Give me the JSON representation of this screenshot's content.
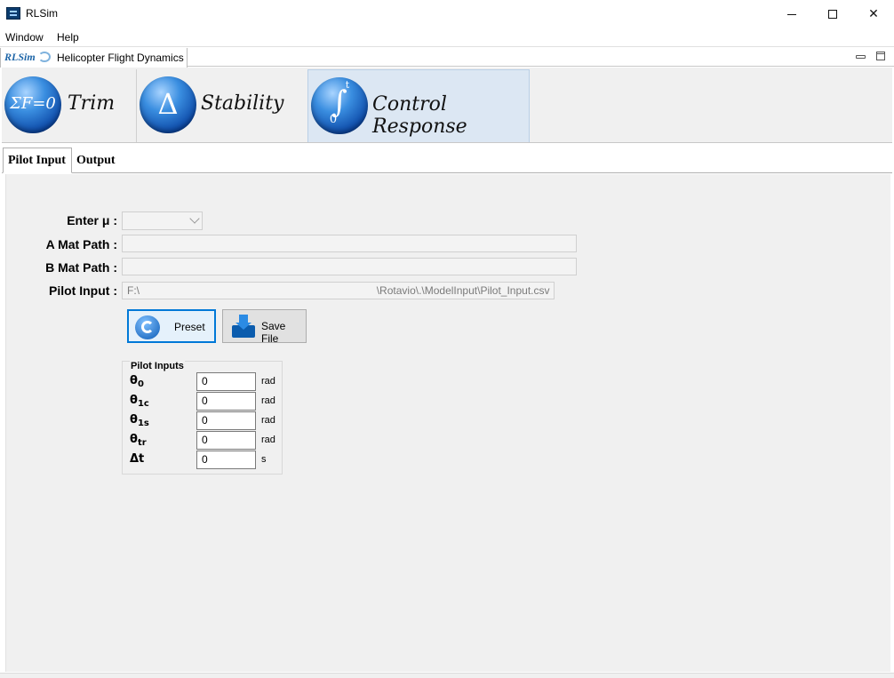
{
  "window": {
    "title": "RLSim",
    "min_label": "",
    "max_label": "",
    "close_label": "✕"
  },
  "menu": {
    "items": [
      "Window",
      "Help"
    ]
  },
  "view_tab": {
    "logo": "RLSim",
    "label": "Helicopter Flight Dynamics"
  },
  "modes": [
    {
      "label": "Trim",
      "icon_text": "ΣF=0",
      "icon": "sum-forces-icon"
    },
    {
      "label": "Stability",
      "icon_text": "Δ",
      "icon": "delta-icon"
    },
    {
      "label": "Control Response",
      "icon_text": "∫",
      "icon_sub": "0",
      "icon_sup": "t",
      "icon": "integral-icon",
      "selected": true
    }
  ],
  "subtabs": [
    {
      "label": "Pilot Input",
      "selected": true
    },
    {
      "label": "Output",
      "selected": false
    }
  ],
  "form": {
    "mu_label": "Enter μ :",
    "mu_value": "",
    "a_mat_label": "A Mat Path :",
    "a_mat_value": "",
    "b_mat_label": "B Mat Path :",
    "b_mat_value": "",
    "pilot_input_label": "Pilot Input :",
    "pilot_input_value": "F:\\                                                                                \\Rotavio\\.\\ModelInput\\Pilot_Input.csv"
  },
  "buttons": {
    "preset": "Preset",
    "save_file": "Save File"
  },
  "pilot_inputs": {
    "title": "Pilot Inputs",
    "rows": [
      {
        "symbol": "θ",
        "sub": "0",
        "value": "0",
        "unit": "rad"
      },
      {
        "symbol": "θ",
        "sub": "1c",
        "value": "0",
        "unit": "rad"
      },
      {
        "symbol": "θ",
        "sub": "1s",
        "value": "0",
        "unit": "rad"
      },
      {
        "symbol": "θ",
        "sub": "tr",
        "value": "0",
        "unit": "rad"
      },
      {
        "symbol": "Δt",
        "sub": "",
        "value": "0",
        "unit": "s"
      }
    ]
  },
  "colors": {
    "accent": "#0078d7",
    "orb": "#0d4aa8",
    "selected_tab": "#dce7f3",
    "panel": "#f0f0f0"
  }
}
